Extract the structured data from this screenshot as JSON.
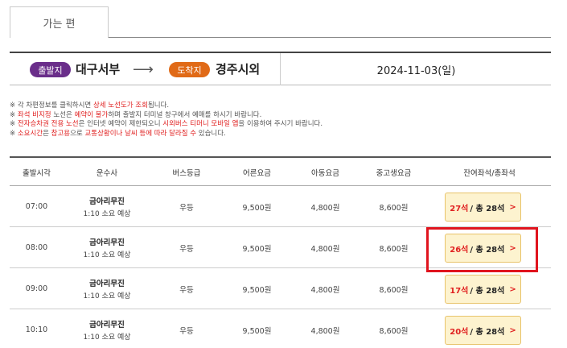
{
  "tab": {
    "label": "가는 편"
  },
  "route": {
    "departure_badge": "출발지",
    "departure_city": "대구서부",
    "arrow": "⟶",
    "arrival_badge": "도착지",
    "arrival_city": "경주시외",
    "date": "2024-11-03(일)"
  },
  "notes": [
    {
      "mark": "※",
      "parts": [
        {
          "t": " 각 차편정보를 클릭하시면 "
        },
        {
          "t": "상세 노선도가 조회",
          "red": true
        },
        {
          "t": "됩니다."
        }
      ]
    },
    {
      "mark": "※",
      "parts": [
        {
          "t": " "
        },
        {
          "t": "좌석 비지정",
          "red": true
        },
        {
          "t": " 노선은 "
        },
        {
          "t": "예약이 불가",
          "red": true
        },
        {
          "t": "하며 출발지 터미널 창구에서 예매를 하시기 바랍니다."
        }
      ]
    },
    {
      "mark": "※",
      "parts": [
        {
          "t": " "
        },
        {
          "t": "전자승차권 전용 노선",
          "red": true
        },
        {
          "t": "은 인터넷 예약이 제한되오니 "
        },
        {
          "t": "시외버스 티머니 모바일 앱",
          "red": true
        },
        {
          "t": "을 이용하여 주시기 바랍니다."
        }
      ]
    },
    {
      "mark": "※",
      "parts": [
        {
          "t": " "
        },
        {
          "t": "소요시간",
          "red": true
        },
        {
          "t": "은 "
        },
        {
          "t": "참고용",
          "red": true
        },
        {
          "t": "으로 "
        },
        {
          "t": "교통상황이나 날씨 등에 따라 달라질 수",
          "red": true
        },
        {
          "t": " 있습니다."
        }
      ]
    }
  ],
  "table": {
    "headers": [
      "출발시각",
      "운수사",
      "버스등급",
      "어른요금",
      "아동요금",
      "중고생요금",
      "잔여좌석/총좌석"
    ],
    "rows": [
      {
        "time": "07:00",
        "operator": "금아리무진",
        "duration": "1:10 소요 예상",
        "grade": "우등",
        "adult": "9,500원",
        "child": "4,800원",
        "student": "8,600원",
        "remain": "27석",
        "total": "/ 총 28석"
      },
      {
        "time": "08:00",
        "operator": "금아리무진",
        "duration": "1:10 소요 예상",
        "grade": "우등",
        "adult": "9,500원",
        "child": "4,800원",
        "student": "8,600원",
        "remain": "26석",
        "total": "/ 총 28석"
      },
      {
        "time": "09:00",
        "operator": "금아리무진",
        "duration": "1:10 소요 예상",
        "grade": "우등",
        "adult": "9,500원",
        "child": "4,800원",
        "student": "8,600원",
        "remain": "17석",
        "total": "/ 총 28석"
      },
      {
        "time": "10:10",
        "operator": "금아리무진",
        "duration": "1:10 소요 예상",
        "grade": "우등",
        "adult": "9,500원",
        "child": "4,800원",
        "student": "8,600원",
        "remain": "20석",
        "total": "/ 총 28석"
      }
    ]
  },
  "colors": {
    "departure_badge": "#6a2e8a",
    "arrival_badge": "#e06a17",
    "highlight": "#e0141e",
    "seat_button_bg": "#fdf3cf"
  }
}
